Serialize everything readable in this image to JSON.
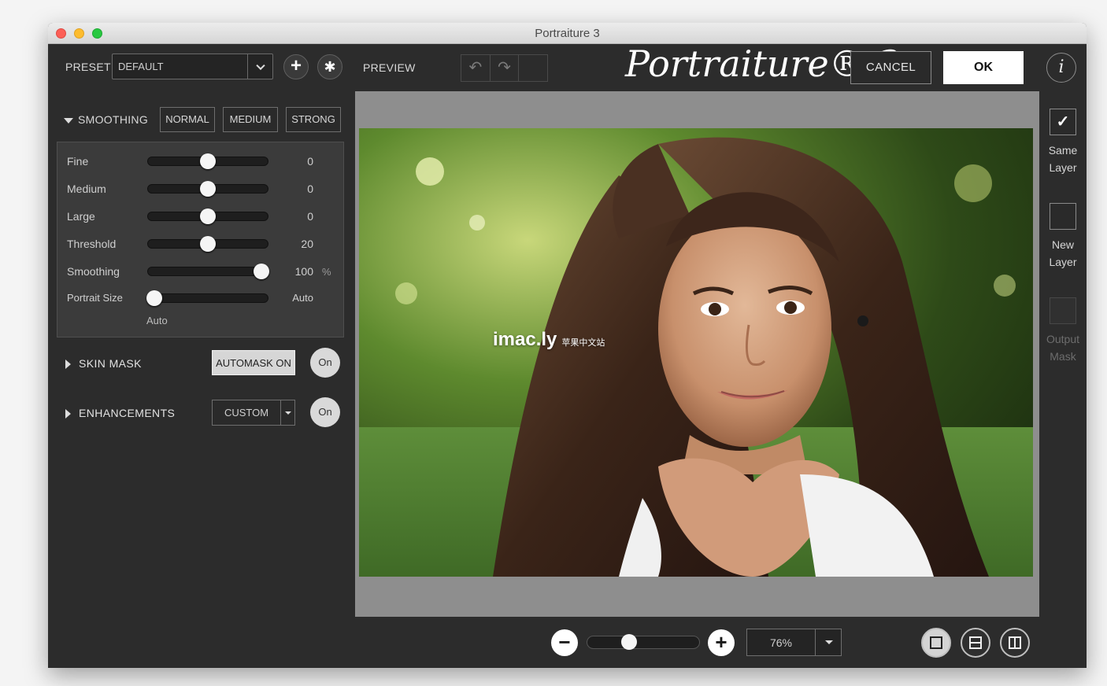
{
  "window": {
    "title": "Portraiture 3"
  },
  "toolbar": {
    "preset_label": "PRESET",
    "preset_value": "DEFAULT",
    "add_icon": "plus-icon",
    "gear_icon": "gear-icon",
    "preview_label": "PREVIEW",
    "logo_text": "Portraiture® 3",
    "cancel_label": "CANCEL",
    "ok_label": "OK",
    "info_label": "i"
  },
  "smoothing": {
    "title": "SMOOTHING",
    "modes": [
      "NORMAL",
      "MEDIUM",
      "STRONG"
    ],
    "sliders": [
      {
        "label": "Fine",
        "value": "0",
        "level": 0.5
      },
      {
        "label": "Medium",
        "value": "0",
        "level": 0.5
      },
      {
        "label": "Large",
        "value": "0",
        "level": 0.5
      },
      {
        "label": "Threshold",
        "value": "20",
        "level": 0.5
      },
      {
        "label": "Smoothing",
        "value": "100",
        "unit": "%",
        "level": 0.95
      },
      {
        "label": "Portrait Size",
        "value": "Auto",
        "sub": "Auto",
        "level": 0.05
      }
    ]
  },
  "skin_mask": {
    "title": "SKIN MASK",
    "automask_label": "AUTOMASK ON",
    "on_label": "On"
  },
  "enhancements": {
    "title": "ENHANCEMENTS",
    "preset_value": "CUSTOM",
    "on_label": "On"
  },
  "side_options": [
    {
      "label_line1": "Same",
      "label_line2": "Layer",
      "checked": true
    },
    {
      "label_line1": "New",
      "label_line2": "Layer",
      "checked": false
    },
    {
      "label_line1": "Output",
      "label_line2": "Mask",
      "checked": false,
      "disabled": true
    }
  ],
  "preview": {
    "watermark": "imac.ly",
    "watermark_sub": "苹果中文站"
  },
  "zoom": {
    "value": "76%",
    "level": 0.37
  },
  "colors": {
    "panel": "#2c2c2c",
    "accent": "#ffffff"
  }
}
